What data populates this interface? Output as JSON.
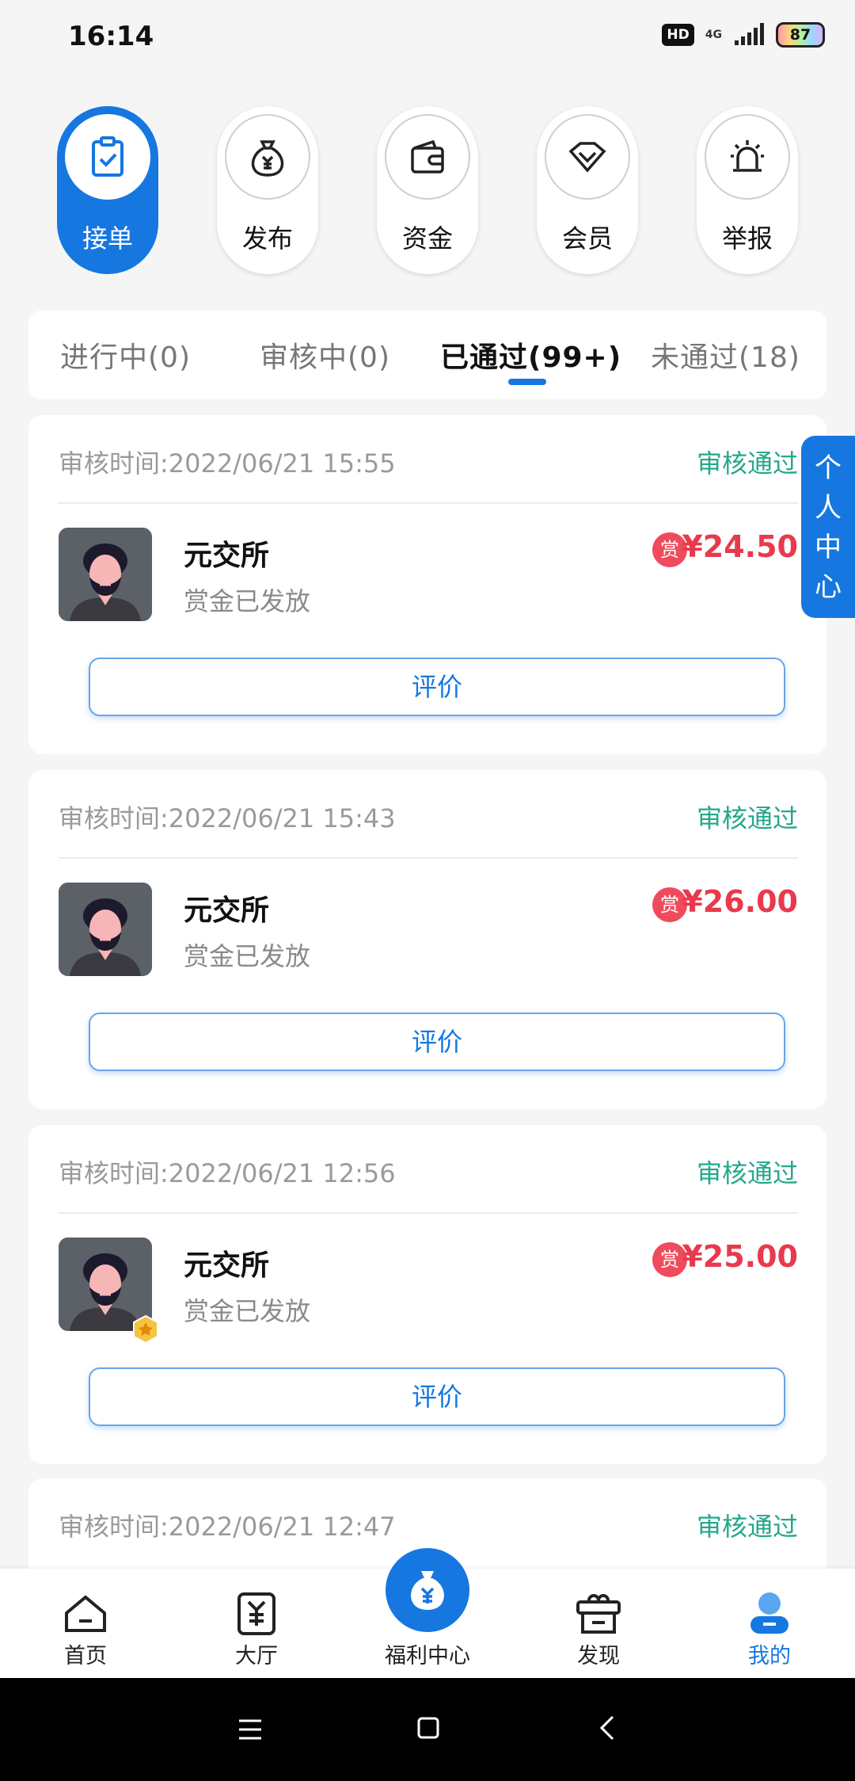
{
  "status_bar": {
    "time": "16:14",
    "hd": "HD",
    "network": "4G",
    "battery": "87"
  },
  "top_nav": [
    {
      "label": "接单",
      "icon": "clipboard-check-icon",
      "active": true
    },
    {
      "label": "发布",
      "icon": "money-bag-icon",
      "active": false
    },
    {
      "label": "资金",
      "icon": "wallet-icon",
      "active": false
    },
    {
      "label": "会员",
      "icon": "diamond-icon",
      "active": false
    },
    {
      "label": "举报",
      "icon": "alarm-light-icon",
      "active": false
    }
  ],
  "tabs": [
    {
      "label": "进行中(0)",
      "active": false
    },
    {
      "label": "审核中(0)",
      "active": false
    },
    {
      "label": "已通过(99+)",
      "active": true
    },
    {
      "label": "未通过(18)",
      "active": false
    }
  ],
  "cards": [
    {
      "time": "审核时间:2022/06/21 15:55",
      "status": "审核通过",
      "name": "元交所",
      "sub": "赏金已发放",
      "reward_icon": "赏",
      "amount": "¥24.50",
      "button": "评价"
    },
    {
      "time": "审核时间:2022/06/21 15:43",
      "status": "审核通过",
      "name": "元交所",
      "sub": "赏金已发放",
      "reward_icon": "赏",
      "amount": "¥26.00",
      "button": "评价"
    },
    {
      "time": "审核时间:2022/06/21 12:56",
      "status": "审核通过",
      "name": "元交所",
      "sub": "赏金已发放",
      "reward_icon": "赏",
      "amount": "¥25.00",
      "button": "评价"
    },
    {
      "time": "审核时间:2022/06/21 12:47",
      "status": "审核通过"
    }
  ],
  "side_tab": {
    "label": "个人中心"
  },
  "bottom_nav": [
    {
      "label": "首页",
      "icon": "home-icon"
    },
    {
      "label": "大厅",
      "icon": "hall-icon"
    },
    {
      "label": "福利中心",
      "icon": "money-bag-icon"
    },
    {
      "label": "发现",
      "icon": "gift-box-icon"
    },
    {
      "label": "我的",
      "icon": "user-icon",
      "active": true
    }
  ],
  "colors": {
    "primary": "#1677e0",
    "success": "#22a88a",
    "price": "#e8394d"
  }
}
